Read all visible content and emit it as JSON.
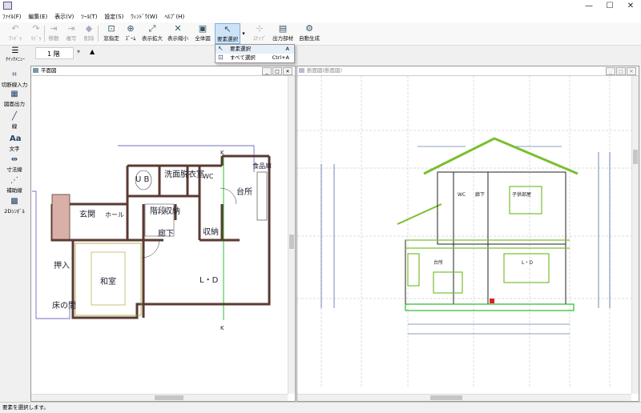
{
  "titlebar": {
    "minimize": "—",
    "maximize": "☐",
    "close": "✕"
  },
  "menu": [
    "ﾌｧｲﾙ(F)",
    "編集(E)",
    "表示(V)",
    "ﾂｰﾙ(T)",
    "設定(S)",
    "ｳｨﾝﾄﾞｳ(W)",
    "ﾍﾙﾌﾟ(H)"
  ],
  "toolbar": {
    "undo": "ｱﾝﾄﾞｩ",
    "redo": "ﾘﾄﾞｩ",
    "move": "移動",
    "copy": "複写",
    "delete": "削除",
    "window_spec": "窓指定",
    "zoom": "ｽﾞｰﾑ",
    "zoom_in": "表示拡大",
    "zoom_out": "表示縮小",
    "full_view": "全体図",
    "select_element": "要素選択",
    "snap": "ｽﾅｯﾌﾟ",
    "output_parts": "出力部材",
    "auto_generate": "自動生成"
  },
  "dropdown": {
    "items": [
      {
        "label": "要素選択",
        "shortcut": "A"
      },
      {
        "label": "すべて選択",
        "shortcut": "Ctrl+A"
      }
    ]
  },
  "floorbar": {
    "quick_menu": "ｸｲｯｸﾒﾆｭｰ",
    "floor": "1 階"
  },
  "sidebar": [
    "切断線入力",
    "図面出力",
    "線",
    "文字",
    "寸法線",
    "補助線",
    "2Dｼﾝﾎﾞﾙ"
  ],
  "windows": {
    "plan_title": "平面図",
    "section_title": "断面図(断面図)"
  },
  "plan": {
    "rooms": {
      "genkan": "玄関",
      "hall": "ホール",
      "ub": "U B",
      "washroom": "洗面脱衣室",
      "wc": "WC",
      "foodstore": "食品庫",
      "kitchen": "台所",
      "stairs": "階段",
      "storage1": "収納",
      "corridor": "廊下",
      "storage2": "収納",
      "oshiire": "押入",
      "washitsu": "和室",
      "tokonoma": "床の間",
      "ld": "L・D"
    },
    "cut_mark_top": "K",
    "cut_mark_bottom": "K"
  },
  "section": {
    "labels": {
      "wc": "WC",
      "corridor": "廊下",
      "closet": "子供部屋",
      "kitchen": "台所",
      "ld": "L・D"
    }
  },
  "status": "要素を選択します。"
}
